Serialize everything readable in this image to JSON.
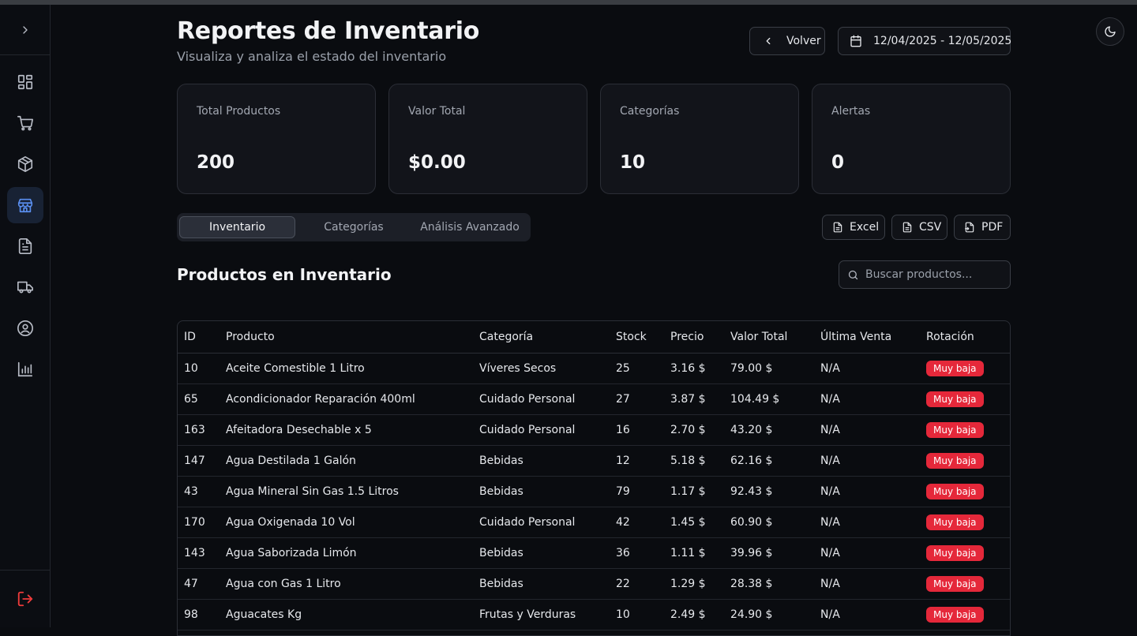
{
  "header": {
    "title": "Reportes de Inventario",
    "subtitle": "Visualiza y analiza el estado del inventario",
    "back_label": "Volver",
    "date_range": "12/04/2025 - 12/05/2025"
  },
  "sidebar": {
    "items": [
      {
        "icon": "dashboard-icon"
      },
      {
        "icon": "cart-icon"
      },
      {
        "icon": "package-icon"
      },
      {
        "icon": "store-icon",
        "active": true
      },
      {
        "icon": "document-icon"
      },
      {
        "icon": "truck-icon"
      },
      {
        "icon": "user-circle-icon"
      },
      {
        "icon": "bar-chart-icon"
      }
    ],
    "logout_icon": "logout-icon"
  },
  "stats": [
    {
      "label": "Total Productos",
      "value": "200"
    },
    {
      "label": "Valor Total",
      "value": "$0.00"
    },
    {
      "label": "Categorías",
      "value": "10"
    },
    {
      "label": "Alertas",
      "value": "0"
    }
  ],
  "tabs": [
    {
      "label": "Inventario",
      "active": true
    },
    {
      "label": "Categorías"
    },
    {
      "label": "Análisis Avanzado"
    }
  ],
  "export": {
    "excel": "Excel",
    "csv": "CSV",
    "pdf": "PDF"
  },
  "section_title": "Productos en Inventario",
  "search": {
    "placeholder": "Buscar productos..."
  },
  "table": {
    "columns": [
      "ID",
      "Producto",
      "Categoría",
      "Stock",
      "Precio",
      "Valor Total",
      "Última Venta",
      "Rotación"
    ],
    "rows": [
      [
        "10",
        "Aceite Comestible 1 Litro",
        "Víveres Secos",
        "25",
        "3.16 $",
        "79.00 $",
        "N/A",
        "Muy baja"
      ],
      [
        "65",
        "Acondicionador Reparación 400ml",
        "Cuidado Personal",
        "27",
        "3.87 $",
        "104.49 $",
        "N/A",
        "Muy baja"
      ],
      [
        "163",
        "Afeitadora Desechable x 5",
        "Cuidado Personal",
        "16",
        "2.70 $",
        "43.20 $",
        "N/A",
        "Muy baja"
      ],
      [
        "147",
        "Agua Destilada 1 Galón",
        "Bebidas",
        "12",
        "5.18 $",
        "62.16 $",
        "N/A",
        "Muy baja"
      ],
      [
        "43",
        "Agua Mineral Sin Gas 1.5 Litros",
        "Bebidas",
        "79",
        "1.17 $",
        "92.43 $",
        "N/A",
        "Muy baja"
      ],
      [
        "170",
        "Agua Oxigenada 10 Vol",
        "Cuidado Personal",
        "42",
        "1.45 $",
        "60.90 $",
        "N/A",
        "Muy baja"
      ],
      [
        "143",
        "Agua Saborizada Limón",
        "Bebidas",
        "36",
        "1.11 $",
        "39.96 $",
        "N/A",
        "Muy baja"
      ],
      [
        "47",
        "Agua con Gas 1 Litro",
        "Bebidas",
        "22",
        "1.29 $",
        "28.38 $",
        "N/A",
        "Muy baja"
      ],
      [
        "98",
        "Aguacates Kg",
        "Frutas y Verduras",
        "10",
        "2.49 $",
        "24.90 $",
        "N/A",
        "Muy baja"
      ]
    ]
  },
  "colors": {
    "accent": "#5a8ff0",
    "danger": "#e5283a",
    "background": "#0a0c10"
  }
}
